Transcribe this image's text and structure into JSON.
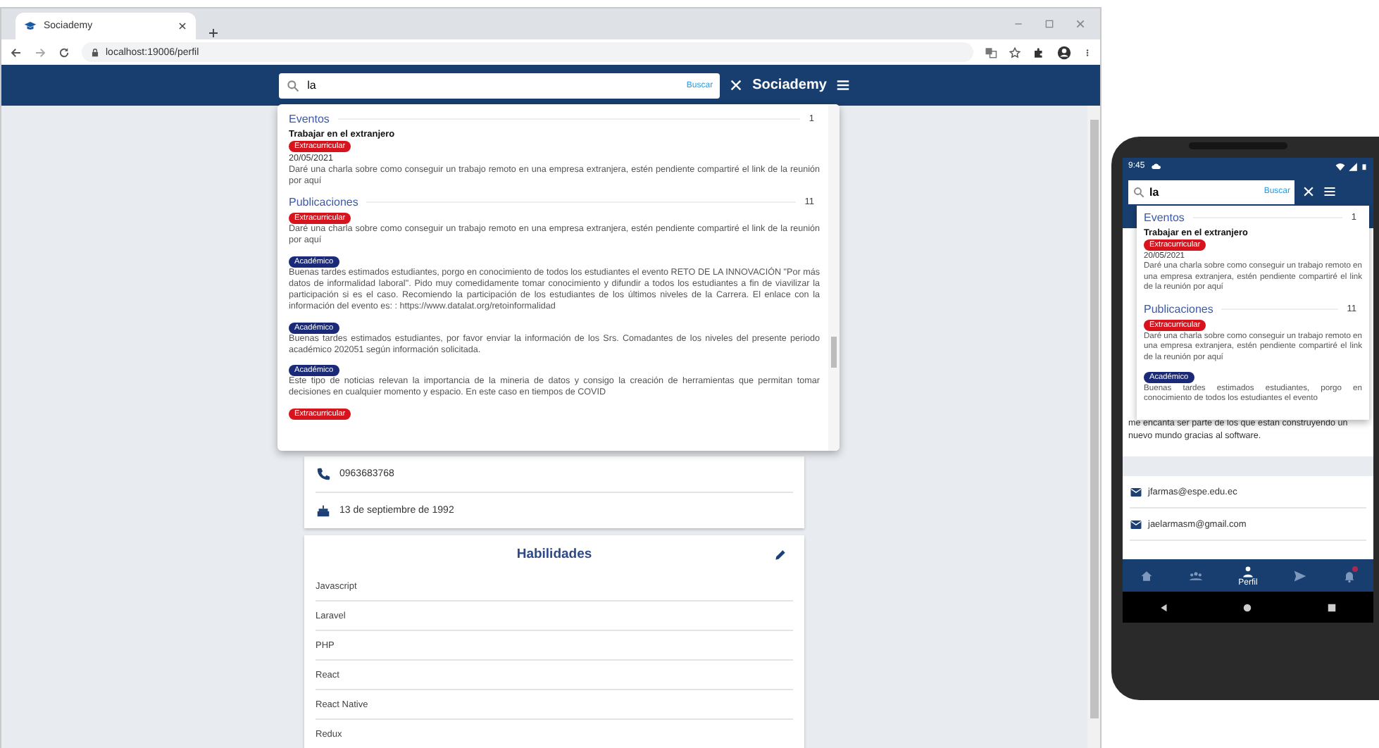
{
  "browser": {
    "tab_title": "Sociademy",
    "url": "localhost:19006/perfil"
  },
  "header": {
    "search": {
      "value": "la"
    },
    "search_button": "Buscar",
    "brand": "Sociademy"
  },
  "search_results": {
    "sections": [
      {
        "title": "Eventos",
        "count": "1",
        "items": [
          {
            "title": "Trabajar en el extranjero",
            "tag": {
              "label": "Extracurricular",
              "color": "#d7141d"
            },
            "date": "20/05/2021",
            "text": "Daré una charla sobre como conseguir un trabajo remoto en una empresa extranjera, estén pendiente compartiré el link de la reunión por aquí"
          }
        ]
      },
      {
        "title": "Publicaciones",
        "count": "11",
        "items": [
          {
            "tag": {
              "label": "Extracurricular",
              "color": "#d7141d"
            },
            "text": "Daré una charla sobre como conseguir un trabajo remoto en una empresa extranjera, estén pendiente compartiré el link de la reunión por aquí"
          },
          {
            "tag": {
              "label": "Académico",
              "color": "#1b2a78"
            },
            "text": "Buenas tardes estimados estudiantes, porgo en conocimiento de todos los estudiantes el evento RETO DE LA INNOVACIÓN \"Por más datos de informalidad laboral\". Pido muy comedidamente tomar conocimiento y difundir a todos los estudiantes a fin de viavilizar la participación si es el caso. Recomiendo la participación de los estudiantes de los últimos niveles de la Carrera. El enlace con la información del evento es: : https://www.datalat.org/retoinformalidad"
          },
          {
            "tag": {
              "label": "Académico",
              "color": "#1b2a78"
            },
            "text": "Buenas tardes estimados estudiantes, por favor enviar la información de los Srs. Comadantes de los niveles del presente periodo académico 202051 según información solicitada."
          },
          {
            "tag": {
              "label": "Académico",
              "color": "#1b2a78"
            },
            "text": "Este tipo de noticias relevan la importancia  de la mineria de datos y consigo la creación de herramientas que permitan tomar decisiones en cualquier momento y espacio. En este caso en tiempos de COVID"
          },
          {
            "tag": {
              "label": "Extracurricular",
              "color": "#d7141d"
            }
          }
        ]
      }
    ]
  },
  "profile": {
    "contacts": [
      {
        "kind": "phone",
        "text": "0963683768"
      },
      {
        "kind": "birthday",
        "text": "13 de septiembre de 1992"
      }
    ],
    "skills": {
      "title": "Habilidades",
      "items": [
        "Javascript",
        "Laravel",
        "PHP",
        "React",
        "React Native",
        "Redux"
      ]
    }
  },
  "phone": {
    "time": "9:45",
    "search": {
      "value": "la"
    },
    "search_button": "Buscar",
    "results": {
      "sections": [
        {
          "title": "Eventos",
          "count": "1",
          "items": [
            {
              "title": "Trabajar en el extranjero",
              "tag": {
                "label": "Extracurricular",
                "color": "#d7141d"
              },
              "date": "20/05/2021",
              "text": "Daré una charla sobre como conseguir un trabajo remoto en una empresa extranjera, estén pendiente compartiré el link de la reunión por aquí"
            }
          ]
        },
        {
          "title": "Publicaciones",
          "count": "11",
          "items": [
            {
              "tag": {
                "label": "Extracurricular",
                "color": "#d7141d"
              },
              "text": "Daré una charla sobre como conseguir un trabajo remoto en una empresa extranjera, estén pendiente compartiré el link de la reunión por aquí"
            },
            {
              "tag": {
                "label": "Académico",
                "color": "#1b2a78"
              },
              "text": "Buenas tardes estimados estudiantes, porgo en conocimiento de todos los estudiantes el evento"
            }
          ]
        }
      ]
    },
    "about": "me encanta ser parte de los que estan construyendo un nuevo mundo gracias al software.",
    "contacts": [
      {
        "kind": "email",
        "text": "jfarmas@espe.edu.ec"
      },
      {
        "kind": "email",
        "text": "jaelarmasm@gmail.com"
      }
    ],
    "nav": [
      {
        "kind": "home",
        "selected": false,
        "alert": false
      },
      {
        "kind": "groups",
        "selected": false,
        "alert": false
      },
      {
        "kind": "profile",
        "label": "Perfil",
        "selected": true,
        "alert": false
      },
      {
        "kind": "send",
        "selected": false,
        "alert": false
      },
      {
        "kind": "notifications",
        "selected": false,
        "alert": true
      }
    ]
  }
}
